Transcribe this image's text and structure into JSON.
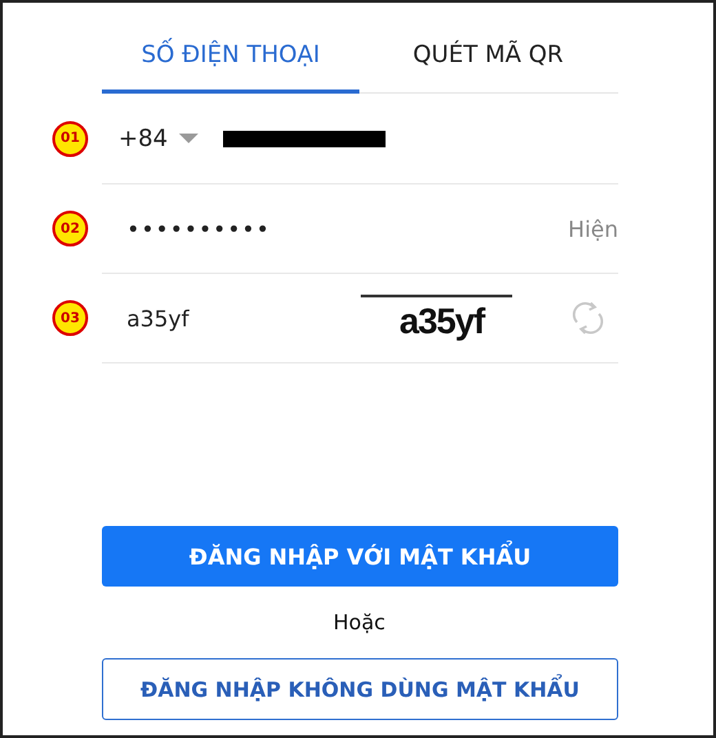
{
  "tabs": [
    {
      "label": "SỐ ĐIỆN THOẠI",
      "selected": true
    },
    {
      "label": "QUÉT MÃ QR",
      "selected": false
    }
  ],
  "fields": [
    {
      "kind": "phone",
      "step": "01",
      "country_code": "+84",
      "redacted": true
    },
    {
      "kind": "password",
      "step": "02",
      "value": "••••••••••",
      "toggle": "Hiện"
    },
    {
      "kind": "captcha",
      "step": "03",
      "value": "a35yf",
      "captcha_text": "a35yf"
    }
  ],
  "login_button": "ĐĂNG NHẬP VỚI MẬT KHẨU",
  "separator": "Hoặc",
  "alt_login_button": "ĐĂNG NHẬP KHÔNG DÙNG MẬT KHẨU"
}
